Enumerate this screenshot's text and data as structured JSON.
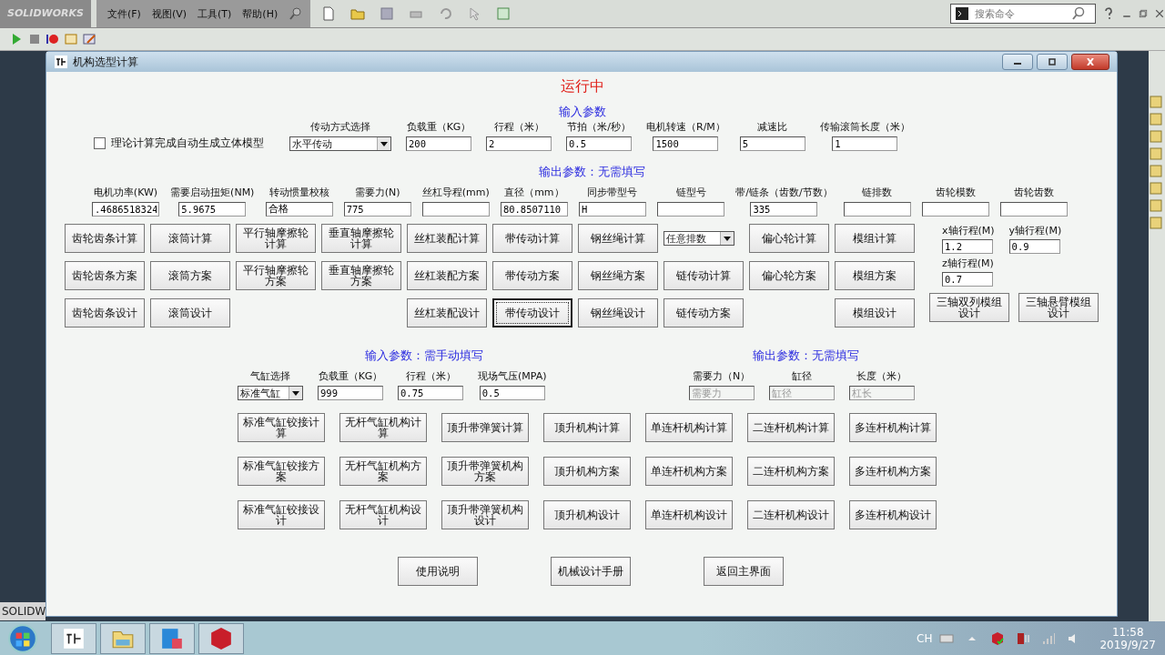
{
  "app_bar": {
    "logo": "SOLIDWORKS",
    "menus": [
      "文件(F)",
      "视图(V)",
      "工具(T)",
      "帮助(H)"
    ],
    "search": {
      "placeholder": "搜索命令"
    }
  },
  "side_label": "SOLIDW",
  "dialog": {
    "title": "机构选型计算",
    "status": "运行中",
    "input_heading": "输入参数",
    "auto_model": {
      "label": "理论计算完成自动生成立体模型",
      "checked": false
    },
    "inputs": [
      {
        "kind": "select",
        "label": "传动方式选择",
        "value": "水平传动"
      },
      {
        "kind": "text",
        "label": "负载重（KG）",
        "value": "200"
      },
      {
        "kind": "text",
        "label": "行程（米）",
        "value": "2"
      },
      {
        "kind": "text",
        "label": "节拍（米/秒）",
        "value": "0.5"
      },
      {
        "kind": "text",
        "label": "电机转速（R/M）",
        "value": "1500"
      },
      {
        "kind": "text",
        "label": "减速比",
        "value": "5"
      },
      {
        "kind": "text",
        "label": "传输滚筒长度（米）",
        "value": "1"
      }
    ],
    "output_heading": "输出参数：无需填写",
    "outputs": [
      {
        "label": "电机功率(KW)",
        "value": ".4686518324"
      },
      {
        "label": "需要启动扭矩(NM)",
        "value": "5.9675"
      },
      {
        "label": "转动惯量校核",
        "value": "合格"
      },
      {
        "label": "需要力(N)",
        "value": "775"
      },
      {
        "label": "丝杠导程(mm)"
      },
      {
        "label": "直径（mm）",
        "value": "80.8507110"
      },
      {
        "label": "同步带型号",
        "value": "H"
      },
      {
        "label": "链型号"
      },
      {
        "label": "带/链条（齿数/节数）",
        "value": "335"
      },
      {
        "label": "链排数"
      },
      {
        "label": "齿轮模数"
      },
      {
        "label": "齿轮齿数"
      }
    ],
    "mech_buttons": [
      [
        {
          "kind": "button",
          "label": "齿轮齿条计算",
          "focused": false
        },
        {
          "kind": "button",
          "label": "滚筒计算",
          "focused": false
        },
        {
          "kind": "button",
          "label": "平行轴摩擦轮计算",
          "focused": false
        },
        {
          "kind": "button",
          "label": "垂直轴摩擦轮计算",
          "focused": false
        },
        {
          "kind": "button",
          "label": "丝杠装配计算",
          "focused": false
        },
        {
          "kind": "button",
          "label": "带传动计算",
          "focused": false
        },
        {
          "kind": "button",
          "label": "钢丝绳计算",
          "focused": false
        },
        {
          "kind": "select",
          "label": "任意排数"
        },
        {
          "kind": "button",
          "label": "偏心轮计算",
          "focused": false
        },
        {
          "kind": "button",
          "label": "模组计算",
          "focused": false
        }
      ],
      [
        {
          "kind": "button",
          "label": "齿轮齿条方案",
          "focused": false
        },
        {
          "kind": "button",
          "label": "滚筒方案",
          "focused": false
        },
        {
          "kind": "button",
          "label": "平行轴摩擦轮方案",
          "focused": false
        },
        {
          "kind": "button",
          "label": "垂直轴摩擦轮方案",
          "focused": false
        },
        {
          "kind": "button",
          "label": "丝杠装配方案",
          "focused": false
        },
        {
          "kind": "button",
          "label": "带传动方案",
          "focused": false
        },
        {
          "kind": "button",
          "label": "钢丝绳方案",
          "focused": false
        },
        {
          "kind": "button",
          "label": "链传动计算",
          "focused": false
        },
        {
          "kind": "button",
          "label": "偏心轮方案",
          "focused": false
        },
        {
          "kind": "button",
          "label": "模组方案",
          "focused": false
        }
      ],
      [
        {
          "kind": "button",
          "label": "齿轮齿条设计",
          "focused": false
        },
        {
          "kind": "button",
          "label": "滚筒设计",
          "focused": false
        },
        {
          "kind": "gap"
        },
        {
          "kind": "gap"
        },
        {
          "kind": "button",
          "label": "丝杠装配设计",
          "focused": false
        },
        {
          "kind": "button",
          "label": "带传动设计",
          "focused": true
        },
        {
          "kind": "button",
          "label": "钢丝绳设计",
          "focused": false
        },
        {
          "kind": "button",
          "label": "链传动方案",
          "focused": false
        },
        {
          "kind": "gap"
        },
        {
          "kind": "button",
          "label": "模组设计",
          "focused": false
        }
      ]
    ],
    "axis_inputs": [
      {
        "label": "x轴行程(M)",
        "value": "1.2"
      },
      {
        "label": "y轴行程(M)",
        "value": "0.9"
      },
      {
        "label": "z轴行程(M)",
        "value": "0.7"
      }
    ],
    "axis_buttons": [
      "三轴双列模组设计",
      "三轴悬臂模组设计"
    ],
    "cyl_input_heading": "输入参数：需手动填写",
    "cyl_output_heading": "输出参数：无需填写",
    "cyl_inputs": [
      {
        "kind": "select",
        "label": "气缸选择",
        "value": "标准气缸"
      },
      {
        "kind": "text",
        "label": "负载重（KG）",
        "value": "999"
      },
      {
        "kind": "text",
        "label": "行程（米）",
        "value": "0.75"
      },
      {
        "kind": "text",
        "label": "现场气压(MPA)",
        "value": "0.5"
      }
    ],
    "cyl_outputs": [
      {
        "label": "需要力（N）",
        "placeholder": "需要力"
      },
      {
        "label": "缸径",
        "placeholder": "缸径"
      },
      {
        "label": "长度（米）",
        "placeholder": "杠长"
      }
    ],
    "cyl_buttons": [
      [
        "标准气缸铰接计算",
        "无杆气缸机构计算",
        "顶升带弹簧计算",
        "顶升机构计算",
        "单连杆机构计算",
        "二连杆机构计算",
        "多连杆机构计算"
      ],
      [
        "标准气缸铰接方案",
        "无杆气缸机构方案",
        "顶升带弹簧机构方案",
        "顶升机构方案",
        "单连杆机构方案",
        "二连杆机构方案",
        "多连杆机构方案"
      ],
      [
        "标准气缸铰接设计",
        "无杆气缸机构设计",
        "顶升带弹簧机构设计",
        "顶升机构设计",
        "单连杆机构设计",
        "二连杆机构设计",
        "多连杆机构设计"
      ]
    ],
    "footer_buttons": [
      "使用说明",
      "机械设计手册",
      "返回主界面"
    ]
  },
  "taskbar": {
    "language": "CH",
    "time": "11:58",
    "date": "2019/9/27"
  }
}
